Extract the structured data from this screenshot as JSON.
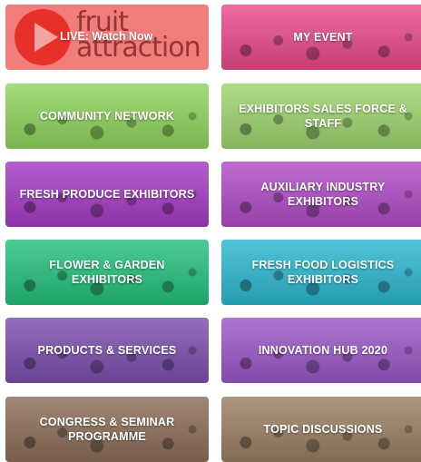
{
  "tiles": [
    {
      "label": "LIVE: Watch Now",
      "brand": "fruit attraction",
      "color": "#f07d7a"
    },
    {
      "label": "MY EVENT",
      "color": "#e94a8c"
    },
    {
      "label": "COMMUNITY NETWORK",
      "color": "#8fd45d"
    },
    {
      "label": "EXHIBITORS SALES FORCE & STAFF",
      "color": "#9ed46e"
    },
    {
      "label": "FRESH PRODUCE EXHIBITORS",
      "color": "#a43bc4"
    },
    {
      "label": "AUXILIARY INDUSTRY EXHIBITORS",
      "color": "#b04cc6"
    },
    {
      "label": "FLOWER & GARDEN EXHIBITORS",
      "color": "#24c07a"
    },
    {
      "label": "FRESH FOOD LOGISTICS EXHIBITORS",
      "color": "#2cb7cf"
    },
    {
      "label": "PRODUCTS & SERVICES",
      "color": "#7b4fae"
    },
    {
      "label": "INNOVATION HUB 2020",
      "color": "#9b57c7"
    },
    {
      "label": "CONGRESS & SEMINAR PROGRAMME",
      "color": "#8c6e58"
    },
    {
      "label": "TOPIC DISCUSSIONS",
      "color": "#9a7f64"
    }
  ]
}
